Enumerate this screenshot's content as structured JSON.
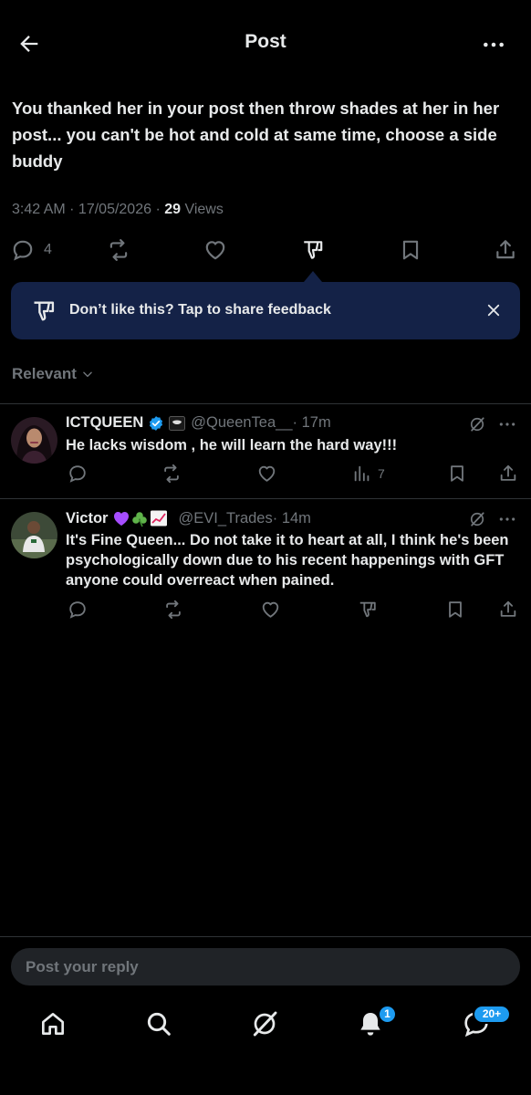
{
  "header": {
    "title": "Post",
    "back_icon": "arrow-left-icon",
    "more_icon": "ellipsis-icon"
  },
  "post": {
    "text": "You thanked her in your post then throw shades at her in her post... you can't be hot and cold at same time, choose a side buddy",
    "timestamp": "3:42 AM · 17/05/2026 · ",
    "views_count": "29",
    "views_label": " Views",
    "replies_count": "4"
  },
  "feedback": {
    "text": "Don’t like this? Tap to share feedback"
  },
  "sort": {
    "label": "Relevant"
  },
  "replies": [
    {
      "name": "ICTQUEEN",
      "handle": "@QueenTea__",
      "time": " · 17m",
      "text": "He lacks wisdom , he will learn the hard way!!!",
      "views": "7"
    },
    {
      "name": "Victor",
      "name_emojis": "💜☘️📈",
      "handle": "@EVI_Trades",
      "time": " · 14m",
      "text": "It's Fine Queen... Do not take it to heart at all, I think he's been psychologically down due to his recent happenings with GFT anyone could overreact when pained."
    }
  ],
  "reply_bar": {
    "placeholder": "Post your reply"
  },
  "nav": {
    "notifications_badge": "1",
    "messages_badge": "20+"
  },
  "colors": {
    "background": "#000000",
    "accent": "#1d9bf0",
    "muted": "#71767b",
    "banner": "#142247",
    "verified": "#1d9bf0"
  }
}
